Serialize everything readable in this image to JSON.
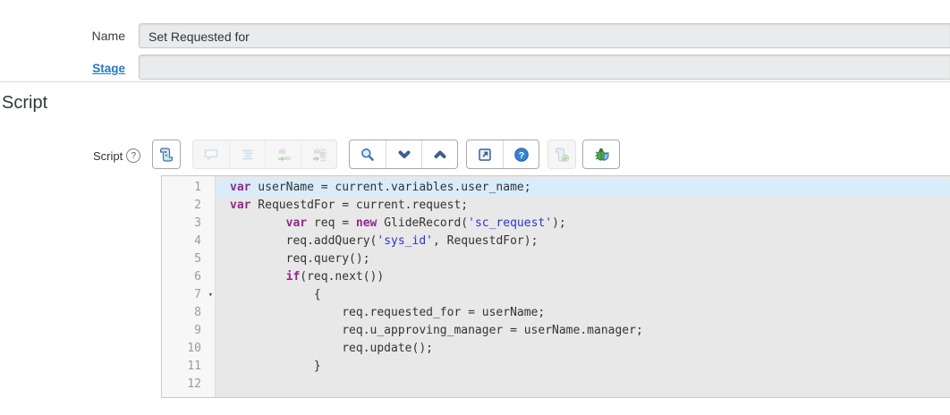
{
  "form": {
    "name": {
      "label": "Name",
      "value": "Set Requested for"
    },
    "stage": {
      "label": "Stage",
      "value": ""
    }
  },
  "section_title": "Script",
  "script_field_label": "Script",
  "help_glyph": "?",
  "toolbar": {
    "icons": [
      "script-scroll",
      "toggle-comment",
      "format-code",
      "replace",
      "replace-all",
      "search",
      "find-next",
      "find-previous",
      "open-in-new-window",
      "help",
      "script-syntax-check",
      "debug"
    ],
    "replace_from": "ab",
    "replace_to": "ac"
  },
  "editor": {
    "active_line": 1,
    "fold_line": 7,
    "fold_glyph": "▾",
    "keywords": [
      "var",
      "new",
      "if"
    ],
    "colors": {
      "keyword": "#90278e",
      "string": "#2d35c8",
      "text": "#333333",
      "active_line_bg": "#d9ecf9"
    },
    "lines": [
      "var userName = current.variables.user_name;",
      "var RequestdFor = current.request;",
      "        var req = new GlideRecord('sc_request');",
      "        req.addQuery('sys_id', RequestdFor);",
      "        req.query();",
      "        if(req.next())",
      "            {",
      "                req.requested_for = userName;",
      "                req.u_approving_manager = userName.manager;",
      "                req.update();",
      "            }",
      ""
    ]
  }
}
